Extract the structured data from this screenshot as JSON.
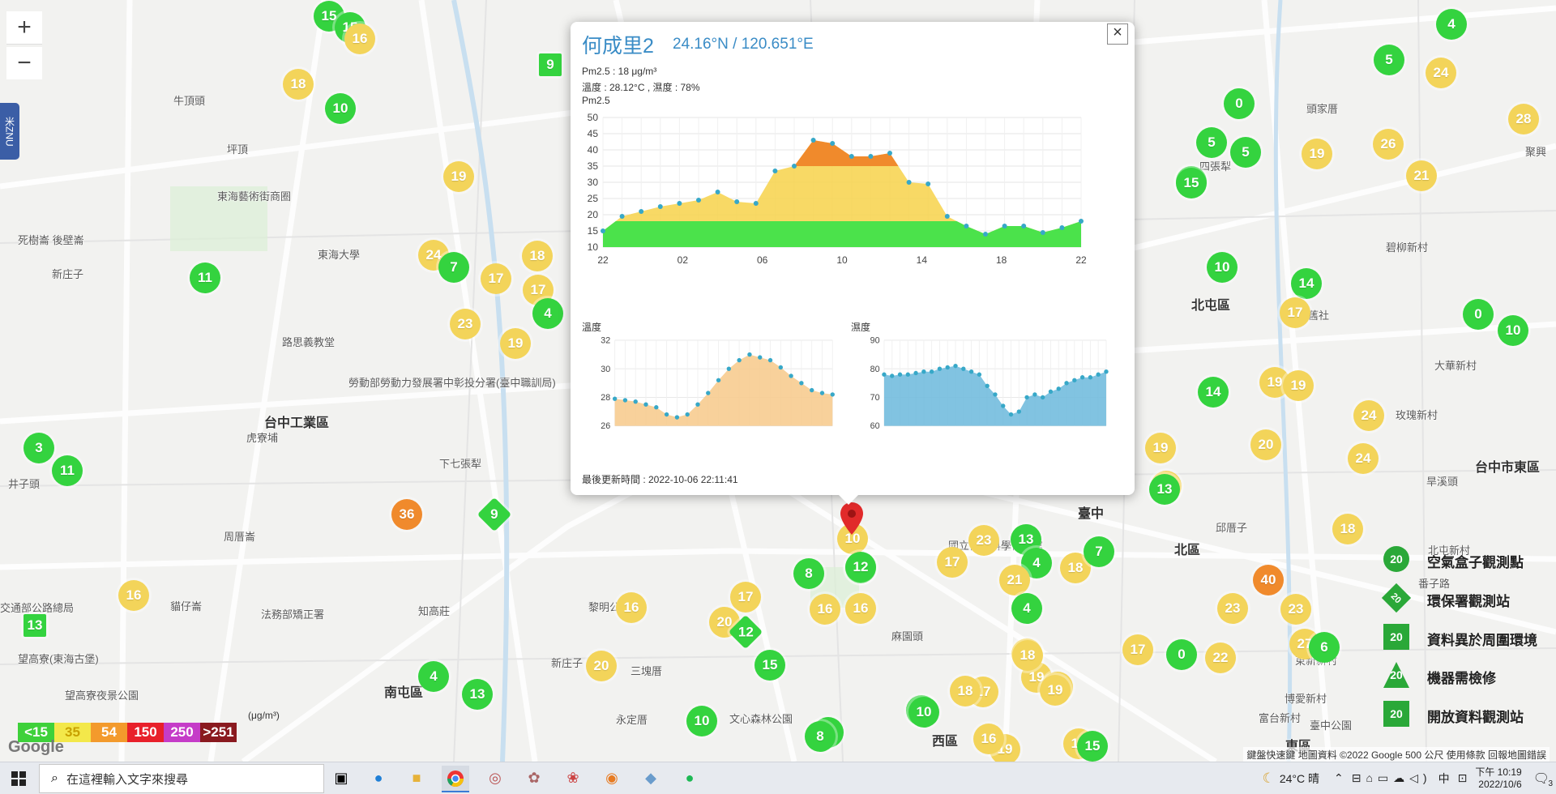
{
  "map": {
    "zoom_in": "+",
    "zoom_out": "−",
    "lang_tab": "米ZNU",
    "labels": [
      {
        "text": "牛頂頭"
      },
      {
        "text": "坪頂"
      },
      {
        "text": "東海藝術街商圈"
      },
      {
        "text": "死樹崙 後壁崙"
      },
      {
        "text": "新庄子"
      },
      {
        "text": "東海大學"
      },
      {
        "text": "路思義教堂"
      },
      {
        "text": "台中工業區"
      },
      {
        "text": "虎寮埔"
      },
      {
        "text": "下七張犁"
      },
      {
        "text": "井子頭"
      },
      {
        "text": "周厝崙"
      },
      {
        "text": "貓仔崙"
      },
      {
        "text": "知高莊"
      },
      {
        "text": "交通部公路總局"
      },
      {
        "text": "望高寮(東海古堡)"
      },
      {
        "text": "望高寮夜景公園"
      },
      {
        "text": "法務部矯正署"
      },
      {
        "text": "南屯區"
      },
      {
        "text": "黎明公園"
      },
      {
        "text": "新庄子"
      },
      {
        "text": "三塊厝"
      },
      {
        "text": "永定厝"
      },
      {
        "text": "麻園頭"
      },
      {
        "text": "文心森林公園"
      },
      {
        "text": "西區"
      },
      {
        "text": "臺中"
      },
      {
        "text": "北區"
      },
      {
        "text": "北屯區"
      },
      {
        "text": "東區"
      },
      {
        "text": "頭家厝"
      },
      {
        "text": "四張犁"
      },
      {
        "text": "碧柳新村"
      },
      {
        "text": "舊社"
      },
      {
        "text": "大華新村"
      },
      {
        "text": "玫瑰新村"
      },
      {
        "text": "台中市東區"
      },
      {
        "text": "旱溪頭"
      },
      {
        "text": "聚興"
      },
      {
        "text": "番子路"
      },
      {
        "text": "邱厝子"
      },
      {
        "text": "國立自然科學博物館"
      },
      {
        "text": "臺中公園"
      },
      {
        "text": "富台新村"
      },
      {
        "text": "博愛新村"
      },
      {
        "text": "勞動部勞動力發展署中彰投分署(臺中職訓局)"
      },
      {
        "text": "東新新村"
      },
      {
        "text": "北屯新村"
      }
    ],
    "markers": [
      {
        "v": "15",
        "c": "green"
      },
      {
        "v": "15",
        "c": "green"
      },
      {
        "v": "16",
        "c": "yellow"
      },
      {
        "v": "18",
        "c": "yellow"
      },
      {
        "v": "10",
        "c": "green"
      },
      {
        "v": "19",
        "c": "yellow"
      },
      {
        "v": "11",
        "c": "green"
      },
      {
        "v": "24",
        "c": "yellow"
      },
      {
        "v": "7",
        "c": "green"
      },
      {
        "v": "17",
        "c": "yellow"
      },
      {
        "v": "18",
        "c": "yellow"
      },
      {
        "v": "17",
        "c": "yellow"
      },
      {
        "v": "4",
        "c": "green"
      },
      {
        "v": "23",
        "c": "yellow"
      },
      {
        "v": "19",
        "c": "yellow"
      },
      {
        "v": "3",
        "c": "green"
      },
      {
        "v": "11",
        "c": "green"
      },
      {
        "v": "36",
        "c": "orange"
      },
      {
        "v": "16",
        "c": "yellow"
      },
      {
        "v": "4",
        "c": "green"
      },
      {
        "v": "13",
        "c": "green"
      },
      {
        "v": "16",
        "c": "yellow"
      },
      {
        "v": "17",
        "c": "yellow"
      },
      {
        "v": "20",
        "c": "yellow"
      },
      {
        "v": "20",
        "c": "yellow"
      },
      {
        "v": "15",
        "c": "green"
      },
      {
        "v": "10",
        "c": "green"
      },
      {
        "v": "8",
        "c": "green"
      },
      {
        "v": "12",
        "c": "green"
      },
      {
        "v": "8",
        "c": "green"
      },
      {
        "v": "16",
        "c": "yellow"
      },
      {
        "v": "16",
        "c": "yellow"
      },
      {
        "v": "10",
        "c": "yellow"
      },
      {
        "v": "12",
        "c": "green"
      },
      {
        "v": "10",
        "c": "green"
      },
      {
        "v": "8",
        "c": "green"
      },
      {
        "v": "23",
        "c": "yellow"
      },
      {
        "v": "17",
        "c": "yellow"
      },
      {
        "v": "13",
        "c": "green"
      },
      {
        "v": "4",
        "c": "green"
      },
      {
        "v": "21",
        "c": "yellow"
      },
      {
        "v": "18",
        "c": "yellow"
      },
      {
        "v": "7",
        "c": "green"
      },
      {
        "v": "4",
        "c": "green"
      },
      {
        "v": "16",
        "c": "yellow"
      },
      {
        "v": "19",
        "c": "yellow"
      },
      {
        "v": "18",
        "c": "yellow"
      },
      {
        "v": "17",
        "c": "yellow"
      },
      {
        "v": "18",
        "c": "yellow"
      },
      {
        "v": "19",
        "c": "yellow"
      },
      {
        "v": "15",
        "c": "green"
      },
      {
        "v": "0",
        "c": "green"
      },
      {
        "v": "5",
        "c": "green"
      },
      {
        "v": "5",
        "c": "green"
      },
      {
        "v": "15",
        "c": "green"
      },
      {
        "v": "19",
        "c": "yellow"
      },
      {
        "v": "26",
        "c": "yellow"
      },
      {
        "v": "21",
        "c": "yellow"
      },
      {
        "v": "28",
        "c": "yellow"
      },
      {
        "v": "4",
        "c": "green"
      },
      {
        "v": "5",
        "c": "green"
      },
      {
        "v": "24",
        "c": "yellow"
      },
      {
        "v": "10",
        "c": "green"
      },
      {
        "v": "14",
        "c": "green"
      },
      {
        "v": "17",
        "c": "yellow"
      },
      {
        "v": "0",
        "c": "green"
      },
      {
        "v": "10",
        "c": "green"
      },
      {
        "v": "19",
        "c": "yellow"
      },
      {
        "v": "19",
        "c": "yellow"
      },
      {
        "v": "14",
        "c": "green"
      },
      {
        "v": "24",
        "c": "yellow"
      },
      {
        "v": "20",
        "c": "yellow"
      },
      {
        "v": "24",
        "c": "yellow"
      },
      {
        "v": "19",
        "c": "yellow"
      },
      {
        "v": "20",
        "c": "yellow"
      },
      {
        "v": "18",
        "c": "yellow"
      },
      {
        "v": "40",
        "c": "orange"
      },
      {
        "v": "23",
        "c": "yellow"
      },
      {
        "v": "23",
        "c": "yellow"
      },
      {
        "v": "27",
        "c": "yellow"
      },
      {
        "v": "6",
        "c": "green"
      },
      {
        "v": "0",
        "c": "green"
      },
      {
        "v": "22",
        "c": "yellow"
      },
      {
        "v": "17",
        "c": "yellow"
      },
      {
        "v": "16",
        "c": "yellow"
      },
      {
        "v": "17",
        "c": "yellow"
      },
      {
        "v": "15",
        "c": "green"
      },
      {
        "v": "10",
        "c": "green"
      },
      {
        "v": "19",
        "c": "yellow"
      },
      {
        "v": "18",
        "c": "yellow"
      },
      {
        "v": "13",
        "c": "green"
      },
      {
        "v": "20",
        "c": "yellow"
      }
    ],
    "diamonds": [
      {
        "v": "9"
      },
      {
        "v": "12"
      }
    ],
    "squares": [
      {
        "v": "9"
      },
      {
        "v": "13"
      }
    ]
  },
  "popup": {
    "title": "何成里2",
    "coords": "24.16°N / 120.651°E",
    "pm25_line": "Pm2.5 : 18 μg/m³",
    "temp_humid_line": "溫度 : 28.12°C , 濕度 : 78%",
    "chart_title": "Pm2.5",
    "temp_title": "溫度",
    "humid_title": "濕度",
    "updated": "最後更新時間 : 2022-10-06 22:11:41",
    "close": "×"
  },
  "chart_data": [
    {
      "type": "area",
      "title": "Pm2.5",
      "x": [
        "22",
        "",
        "",
        "",
        "02",
        "",
        "",
        "",
        "06",
        "",
        "",
        "",
        "10",
        "",
        "",
        "",
        "14",
        "",
        "",
        "",
        "18",
        "",
        "",
        "",
        "22"
      ],
      "xticks": [
        "22",
        "02",
        "06",
        "10",
        "14",
        "18",
        "22"
      ],
      "ylim": [
        10,
        50
      ],
      "yticks": [
        10,
        15,
        20,
        25,
        30,
        35,
        40,
        45,
        50
      ],
      "series": [
        {
          "values": [
            15,
            19.5,
            21,
            22.5,
            23.5,
            24.5,
            27,
            24,
            23.5,
            33.5,
            35,
            43,
            42,
            38,
            38,
            39,
            30,
            29.5,
            19.5,
            16.5,
            14,
            16.5,
            16.5,
            14.5,
            16,
            18
          ]
        }
      ]
    },
    {
      "type": "area",
      "title": "溫度",
      "ylim": [
        26,
        32
      ],
      "yticks": [
        26,
        28,
        30,
        32
      ],
      "series": [
        {
          "values": [
            27.9,
            27.8,
            27.7,
            27.5,
            27.3,
            26.8,
            26.6,
            26.8,
            27.5,
            28.3,
            29.2,
            30,
            30.6,
            31,
            30.8,
            30.6,
            30.1,
            29.5,
            29,
            28.5,
            28.3,
            28.2
          ]
        }
      ]
    },
    {
      "type": "area",
      "title": "濕度",
      "ylim": [
        60,
        90
      ],
      "yticks": [
        60,
        70,
        80,
        90
      ],
      "series": [
        {
          "values": [
            78,
            77.5,
            78,
            78,
            78.5,
            79,
            79,
            80,
            80.5,
            81,
            80,
            79,
            78,
            74,
            71,
            67,
            64,
            65,
            70,
            71,
            70,
            72,
            73,
            75,
            76,
            77,
            77,
            78,
            79
          ]
        }
      ]
    }
  ],
  "legend": {
    "unit": "(μg/m³)",
    "items": [
      {
        "label": "<15",
        "color": "#3ed13a"
      },
      {
        "label": "35",
        "color": "#f3e84a"
      },
      {
        "label": "54",
        "color": "#f39a2c"
      },
      {
        "label": "150",
        "color": "#e8202a"
      },
      {
        "label": "250",
        "color": "#c53cc8"
      },
      {
        "label": ">251",
        "color": "#8a1a1f"
      }
    ]
  },
  "marker_legend": [
    {
      "label": "空氣盒子觀測點",
      "icon": "20"
    },
    {
      "label": "環保署觀測站",
      "icon": "20"
    },
    {
      "label": "資料異於周圍環境",
      "icon": "20"
    },
    {
      "label": "機器需檢修",
      "icon": "20"
    },
    {
      "label": "開放資料觀測站",
      "icon": "20"
    }
  ],
  "google": "Google",
  "attribution": "鍵盤快速鍵  地圖資料 ©2022 Google  500 公尺  使用條款  回報地圖錯誤",
  "taskbar": {
    "search_placeholder": "在這裡輸入文字來搜尋",
    "weather": "24°C 晴",
    "ime": "中",
    "time": "下午 10:19",
    "date": "2022/10/6",
    "notif": "3"
  }
}
